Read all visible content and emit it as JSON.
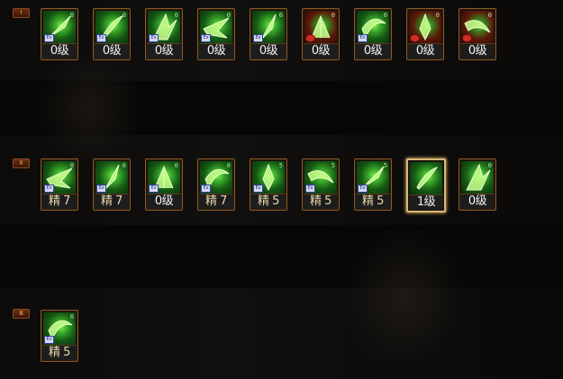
{
  "rows": [
    {
      "marker": "Ⅰ",
      "skills": [
        {
          "label": "0级",
          "num": "0",
          "tag": "Ex",
          "red": false
        },
        {
          "label": "0级",
          "num": "0",
          "tag": "Ex",
          "red": false
        },
        {
          "label": "0级",
          "num": "0",
          "tag": "Ex",
          "red": false
        },
        {
          "label": "0级",
          "num": "0",
          "tag": "Ex",
          "red": false
        },
        {
          "label": "0级",
          "num": "0",
          "tag": "Ex",
          "red": false
        },
        {
          "label": "0级",
          "num": "0",
          "tag": "",
          "red": true
        },
        {
          "label": "0级",
          "num": "0",
          "tag": "Ex",
          "red": false
        },
        {
          "label": "0级",
          "num": "0",
          "tag": "",
          "red": true
        },
        {
          "label": "0级",
          "num": "0",
          "tag": "",
          "red": true
        }
      ]
    },
    {
      "marker": "Ⅱ",
      "skills": [
        {
          "label": "精  7",
          "num": "0",
          "tag": "Ex",
          "red": false
        },
        {
          "label": "精  7",
          "num": "0",
          "tag": "Ex",
          "red": false
        },
        {
          "label": "0级",
          "num": "0",
          "tag": "Ex",
          "red": false
        },
        {
          "label": "精  7",
          "num": "0",
          "tag": "Ex",
          "red": false
        },
        {
          "label": "精  5",
          "num": "5",
          "tag": "Ex",
          "red": false
        },
        {
          "label": "精  5",
          "num": "5",
          "tag": "Ex",
          "red": false
        },
        {
          "label": "精  5",
          "num": "5",
          "tag": "Ex",
          "red": false
        },
        {
          "label": "1级",
          "num": "",
          "tag": "",
          "red": false
        },
        {
          "label": "0级",
          "num": "0",
          "tag": "",
          "red": false
        }
      ]
    },
    {
      "marker": "Ⅲ",
      "skills": [
        {
          "label": "精  5",
          "num": "0",
          "tag": "Ex",
          "red": false
        }
      ]
    }
  ],
  "colors": {
    "frame": "#8a5b27",
    "highlight_frame": "#d8b878",
    "skill_green": "#7cf04a",
    "label_bg": "#1d1d1d"
  }
}
